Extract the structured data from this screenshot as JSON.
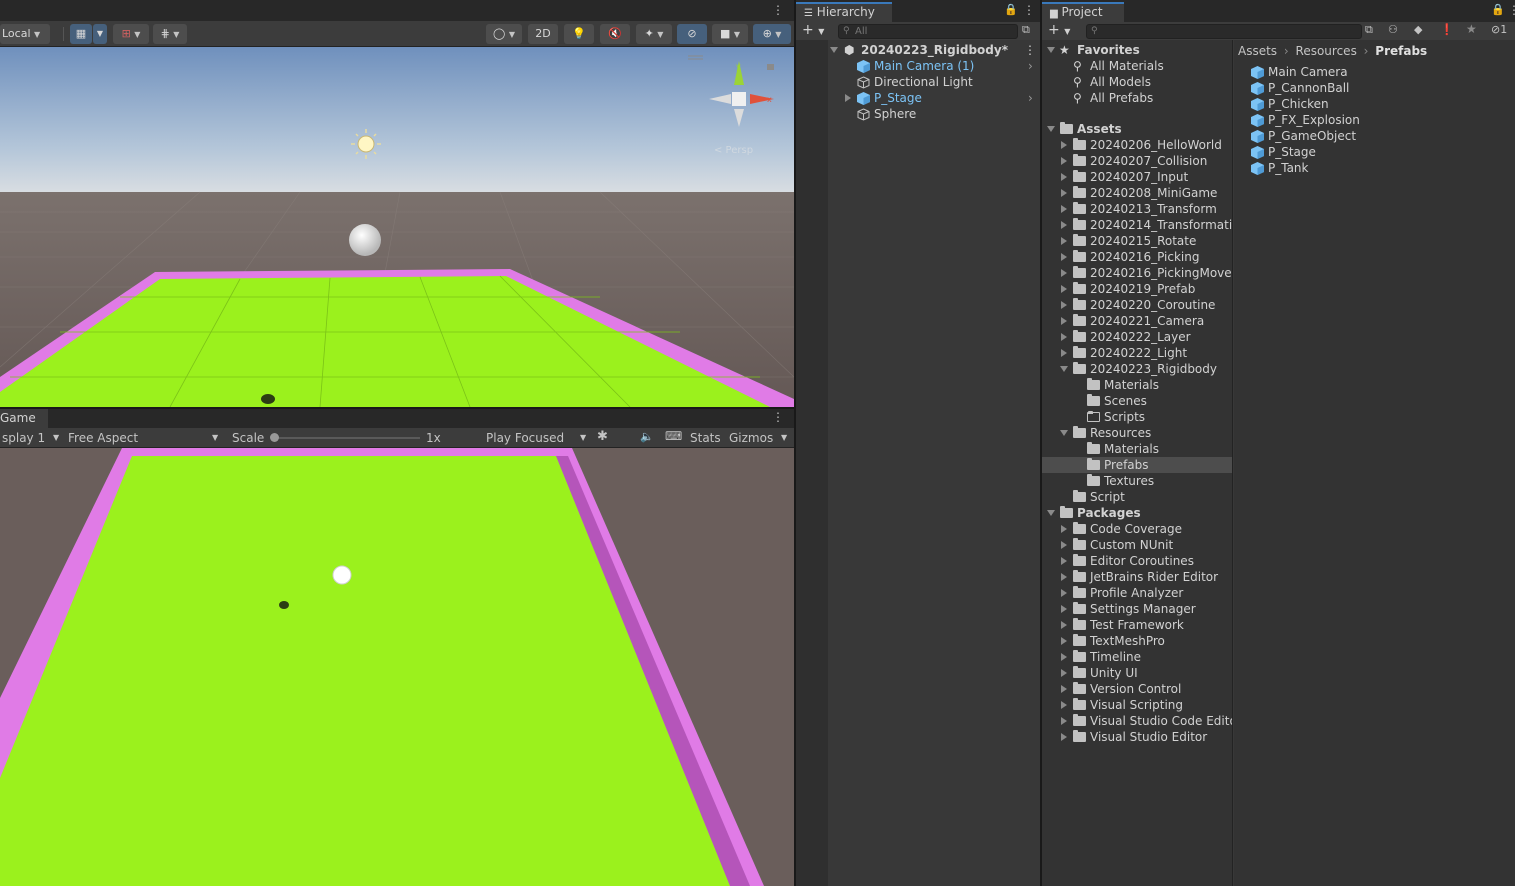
{
  "scene": {
    "pivot_mode_label": "Local",
    "btn_2d": "2D",
    "gizmo_persp_label": "< Persp"
  },
  "game": {
    "tab_label": "Game",
    "display": "splay 1",
    "aspect": "Free Aspect",
    "scale_label": "Scale",
    "scale_value": "1x",
    "play_mode": "Play Focused",
    "stats_label": "Stats",
    "gizmos_label": "Gizmos"
  },
  "hierarchy": {
    "tab_label": "Hierarchy",
    "search_placeholder": "All",
    "scene_name": "20240223_Rigidbody*",
    "items": [
      {
        "label": "Main Camera (1)",
        "prefab": true
      },
      {
        "label": "Directional Light",
        "prefab": false
      },
      {
        "label": "P_Stage",
        "prefab": true
      },
      {
        "label": "Sphere",
        "prefab": false
      }
    ]
  },
  "project": {
    "tab_label": "Project",
    "favorites_label": "Favorites",
    "favorites": [
      "All Materials",
      "All Models",
      "All Prefabs"
    ],
    "assets_label": "Assets",
    "asset_folders": [
      "20240206_HelloWorld",
      "20240207_Collision",
      "20240207_Input",
      "20240208_MiniGame",
      "20240213_Transform",
      "20240214_Transformatio",
      "20240215_Rotate",
      "20240216_Picking",
      "20240216_PickingMove",
      "20240219_Prefab",
      "20240220_Coroutine",
      "20240221_Camera",
      "20240222_Layer",
      "20240222_Light"
    ],
    "rigidbody_folder": "20240223_Rigidbody",
    "rigidbody_children": [
      "Materials",
      "Scenes",
      "Scripts"
    ],
    "resources_folder": "Resources",
    "resources_children": [
      "Materials",
      "Prefabs",
      "Textures"
    ],
    "script_folder": "Script",
    "packages_label": "Packages",
    "packages": [
      "Code Coverage",
      "Custom NUnit",
      "Editor Coroutines",
      "JetBrains Rider Editor",
      "Profile Analyzer",
      "Settings Manager",
      "Test Framework",
      "TextMeshPro",
      "Timeline",
      "Unity UI",
      "Version Control",
      "Visual Scripting",
      "Visual Studio Code Editor",
      "Visual Studio Editor"
    ],
    "breadcrumb": [
      "Assets",
      "Resources",
      "Prefabs"
    ],
    "prefabs": [
      "Main Camera",
      "P_CannonBall",
      "P_Chicken",
      "P_FX_Explosion",
      "P_GameObject",
      "P_Stage",
      "P_Tank"
    ],
    "hidden_count": "1"
  },
  "colors": {
    "accent": "#3a79bb",
    "prefab_blue": "#7cc3f5",
    "ground_green": "#9bf11d",
    "wall_pink": "#e07be6"
  }
}
